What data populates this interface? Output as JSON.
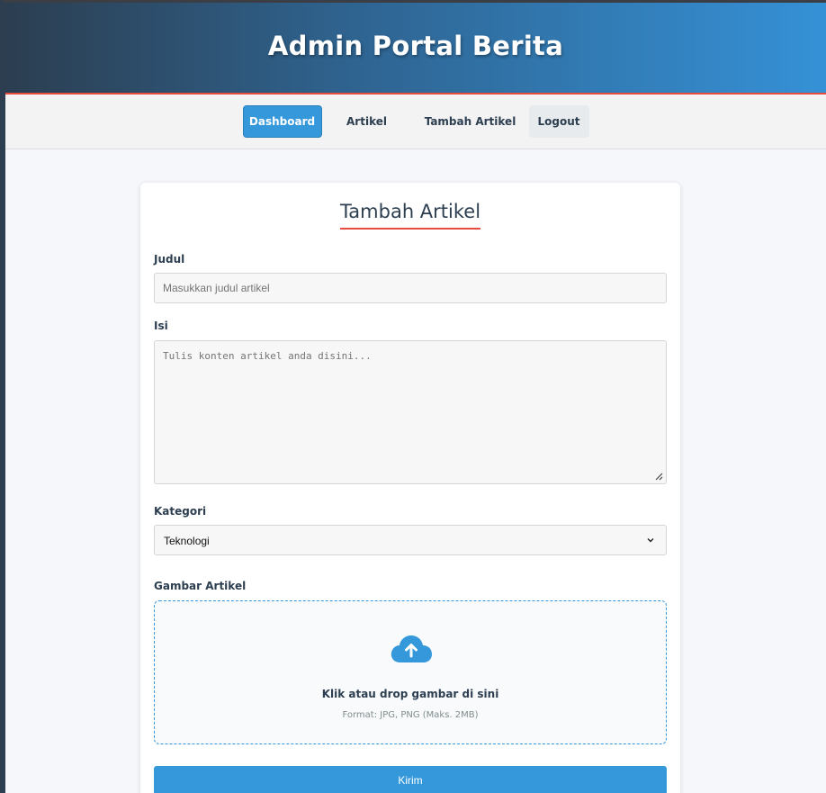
{
  "header": {
    "title": "Admin Portal Berita"
  },
  "nav": {
    "dashboard": "Dashboard",
    "artikel": "Artikel",
    "tambah_artikel": "Tambah Artikel",
    "logout": "Logout"
  },
  "form": {
    "title": "Tambah Artikel",
    "judul_label": "Judul",
    "judul_placeholder": "Masukkan judul artikel",
    "isi_label": "Isi",
    "isi_placeholder": "Tulis konten artikel anda disini...",
    "kategori_label": "Kategori",
    "kategori_value": "Teknologi",
    "gambar_label": "Gambar Artikel",
    "drop_main": "Klik atau drop gambar di sini",
    "drop_sub": "Format: JPG, PNG (Maks. 2MB)",
    "submit": "Kirim"
  },
  "colors": {
    "accent": "#3498db",
    "underline": "#e74c3c",
    "text_dark": "#2c3e50"
  },
  "icons": {
    "upload": "cloud-upload-icon",
    "chevron": "chevron-down-icon",
    "resize": "resize-grip-icon"
  }
}
